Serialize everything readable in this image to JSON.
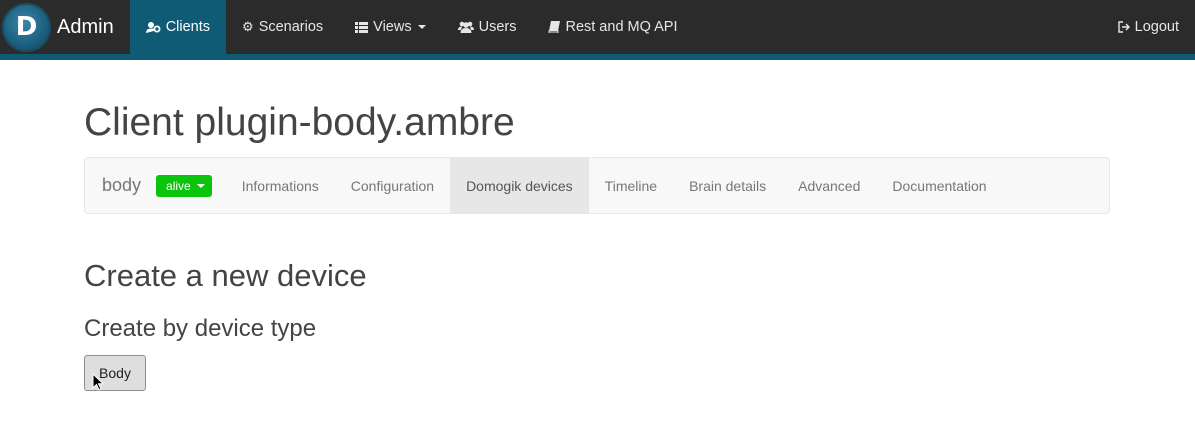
{
  "navbar": {
    "brand": "Admin",
    "items": [
      {
        "label": "Clients",
        "icon": "users-cog-icon",
        "active": true
      },
      {
        "label": "Scenarios",
        "icon": "gear-icon"
      },
      {
        "label": "Views",
        "icon": "list-icon",
        "dropdown": true
      },
      {
        "label": "Users",
        "icon": "users-icon"
      },
      {
        "label": "Rest and MQ API",
        "icon": "book-icon"
      }
    ],
    "logout": "Logout"
  },
  "page": {
    "title": "Client plugin-body.ambre"
  },
  "subnav": {
    "name": "body",
    "status": "alive",
    "status_color": "#0bc40b",
    "tabs": [
      {
        "label": "Informations"
      },
      {
        "label": "Configuration"
      },
      {
        "label": "Domogik devices",
        "active": true
      },
      {
        "label": "Timeline"
      },
      {
        "label": "Brain details"
      },
      {
        "label": "Advanced"
      },
      {
        "label": "Documentation"
      }
    ]
  },
  "main": {
    "heading": "Create a new device",
    "subheading": "Create by device type",
    "device_type_button": "Body"
  },
  "colors": {
    "navbar_bg": "#2b2b2b",
    "accent": "#0f5b75"
  }
}
